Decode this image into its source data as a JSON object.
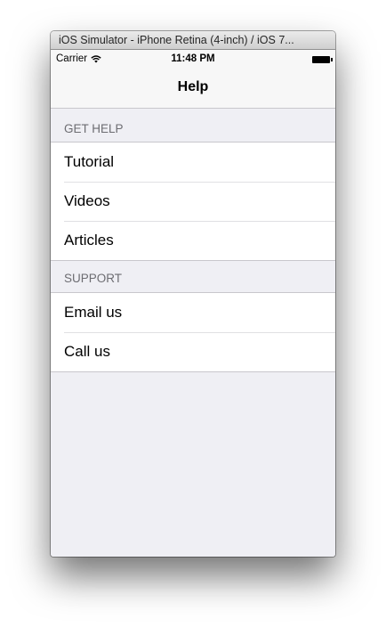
{
  "window": {
    "title": "iOS Simulator - iPhone Retina (4-inch) / iOS 7..."
  },
  "statusbar": {
    "carrier": "Carrier",
    "time": "11:48 PM"
  },
  "navbar": {
    "title": "Help"
  },
  "sections": [
    {
      "header": "GET HELP",
      "items": [
        {
          "label": "Tutorial"
        },
        {
          "label": "Videos"
        },
        {
          "label": "Articles"
        }
      ]
    },
    {
      "header": "SUPPORT",
      "items": [
        {
          "label": "Email us"
        },
        {
          "label": "Call us"
        }
      ]
    }
  ],
  "icons": {
    "wifi": "wifi-icon",
    "battery": "battery-icon"
  }
}
